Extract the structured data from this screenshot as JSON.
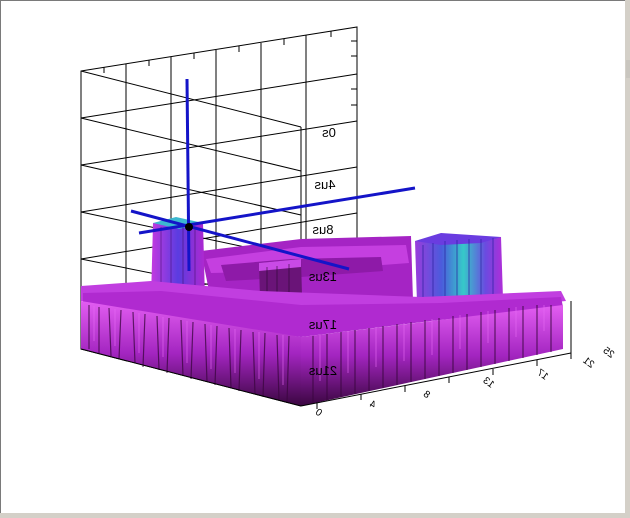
{
  "plot": {
    "time_ticks": [
      "0s",
      "4us",
      "8us",
      "13us",
      "17us",
      "21us"
    ],
    "freq_ticks": [
      "0",
      "4",
      "8",
      "13",
      "17",
      "21",
      "25"
    ],
    "colors": {
      "surface_main": "#b82bd6",
      "surface_dark": "#4a0a52",
      "surface_light": "#e35ef2",
      "peak_cyan": "#36c9c9",
      "peak_blue": "#4b5bdc",
      "cursor": "#1414c8",
      "grid": "#000000"
    }
  }
}
